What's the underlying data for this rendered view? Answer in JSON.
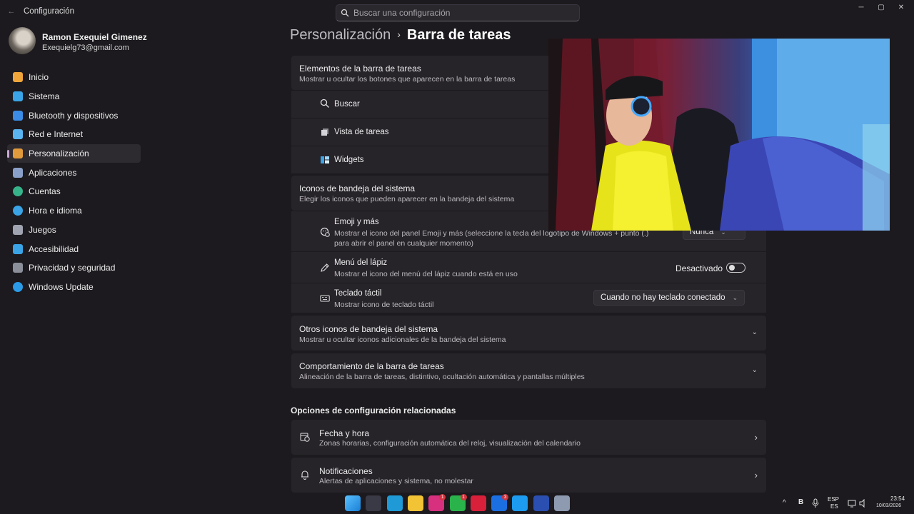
{
  "window": {
    "title": "Configuración",
    "back_glyph": "←",
    "minimize_glyph": "─",
    "maximize_glyph": "▢",
    "close_glyph": "✕"
  },
  "search": {
    "placeholder": "Buscar una configuración",
    "value": ""
  },
  "profile": {
    "name": "Ramon Exequiel Gimenez",
    "email": "Exequielg73@gmail.com"
  },
  "sidebar": {
    "items": [
      {
        "label": "Inicio",
        "icon": "home-icon",
        "color": "#f0a53b"
      },
      {
        "label": "Sistema",
        "icon": "monitor-icon",
        "color": "#3aa4e6"
      },
      {
        "label": "Bluetooth y dispositivos",
        "icon": "bluetooth-icon",
        "color": "#3b8ce6"
      },
      {
        "label": "Red e Internet",
        "icon": "wifi-icon",
        "color": "#5ab4f0"
      },
      {
        "label": "Personalización",
        "icon": "brush-icon",
        "color": "#e09a3c",
        "active": true
      },
      {
        "label": "Aplicaciones",
        "icon": "apps-icon",
        "color": "#8aa0c8"
      },
      {
        "label": "Cuentas",
        "icon": "person-icon",
        "color": "#37b38a"
      },
      {
        "label": "Hora e idioma",
        "icon": "globe-clock-icon",
        "color": "#3aa4e6"
      },
      {
        "label": "Juegos",
        "icon": "gamepad-icon",
        "color": "#a0a4b0"
      },
      {
        "label": "Accesibilidad",
        "icon": "accessibility-icon",
        "color": "#3aa4e6"
      },
      {
        "label": "Privacidad y seguridad",
        "icon": "shield-icon",
        "color": "#8b8f9a"
      },
      {
        "label": "Windows Update",
        "icon": "update-icon",
        "color": "#2b9be8"
      }
    ]
  },
  "breadcrumb": {
    "parent": "Personalización",
    "separator": "›",
    "current": "Barra de tareas"
  },
  "taskbar_items": {
    "title": "Elementos de la barra de tareas",
    "description": "Mostrar u ocultar los botones que aparecen en la barra de tareas",
    "rows": [
      {
        "label": "Buscar",
        "icon": "search-icon"
      },
      {
        "label": "Vista de tareas",
        "icon": "task-view-icon"
      },
      {
        "label": "Widgets",
        "icon": "widgets-icon"
      }
    ]
  },
  "tray_icons": {
    "title": "Iconos de bandeja del sistema",
    "description": "Elegir los iconos que pueden aparecer en la bandeja del sistema",
    "emoji": {
      "title": "Emoji y más",
      "desc1": "Mostrar el icono del panel Emoji y más (seleccione la tecla del logotipo de Windows + punto (.)",
      "desc2": "para abrir el panel en cualquier momento)",
      "value": "Nunca"
    },
    "pen": {
      "title": "Menú del lápiz",
      "desc": "Mostrar el icono del menú del lápiz cuando está en uso",
      "toggle_label": "Desactivado",
      "on": false
    },
    "keyboard": {
      "title": "Teclado táctil",
      "desc": "Mostrar icono de teclado táctil",
      "value": "Cuando no hay teclado conectado"
    }
  },
  "other_tray": {
    "title": "Otros iconos de bandeja del sistema",
    "description": "Mostrar u ocultar iconos adicionales de la bandeja del sistema"
  },
  "behavior": {
    "title": "Comportamiento de la barra de tareas",
    "description": "Alineación de la barra de tareas, distintivo, ocultación automática y pantallas múltiples"
  },
  "related": {
    "header": "Opciones de configuración relacionadas",
    "items": [
      {
        "title": "Fecha y hora",
        "description": "Zonas horarias, configuración automática del reloj, visualización del calendario",
        "icon": "calendar-clock-icon"
      },
      {
        "title": "Notificaciones",
        "description": "Alertas de aplicaciones y sistema, no molestar",
        "icon": "bell-icon"
      }
    ]
  },
  "taskbar": {
    "apps": [
      {
        "name": "start-icon",
        "color": "#2b9be8"
      },
      {
        "name": "search-icon",
        "color": "#3a3a46"
      },
      {
        "name": "edge-icon",
        "color": "#1f9ad6"
      },
      {
        "name": "file-explorer-icon",
        "color": "#f2c335"
      },
      {
        "name": "instagram-icon",
        "color": "#d6307f",
        "badge": "1"
      },
      {
        "name": "whatsapp-icon",
        "color": "#2bb34b",
        "badge": "1"
      },
      {
        "name": "youtube-music-icon",
        "color": "#d8203a"
      },
      {
        "name": "facebook-icon",
        "color": "#1b6fe0",
        "badge": "3"
      },
      {
        "name": "twitter-icon",
        "color": "#1d9bf0"
      },
      {
        "name": "app-icon",
        "color": "#2a4fb0"
      },
      {
        "name": "settings-icon",
        "color": "#8e9ab0"
      }
    ],
    "tray": {
      "overflow_glyph": "^",
      "language": "ESP",
      "language_sub": "ES",
      "time": "23:54",
      "date": "10/03/2026"
    }
  }
}
